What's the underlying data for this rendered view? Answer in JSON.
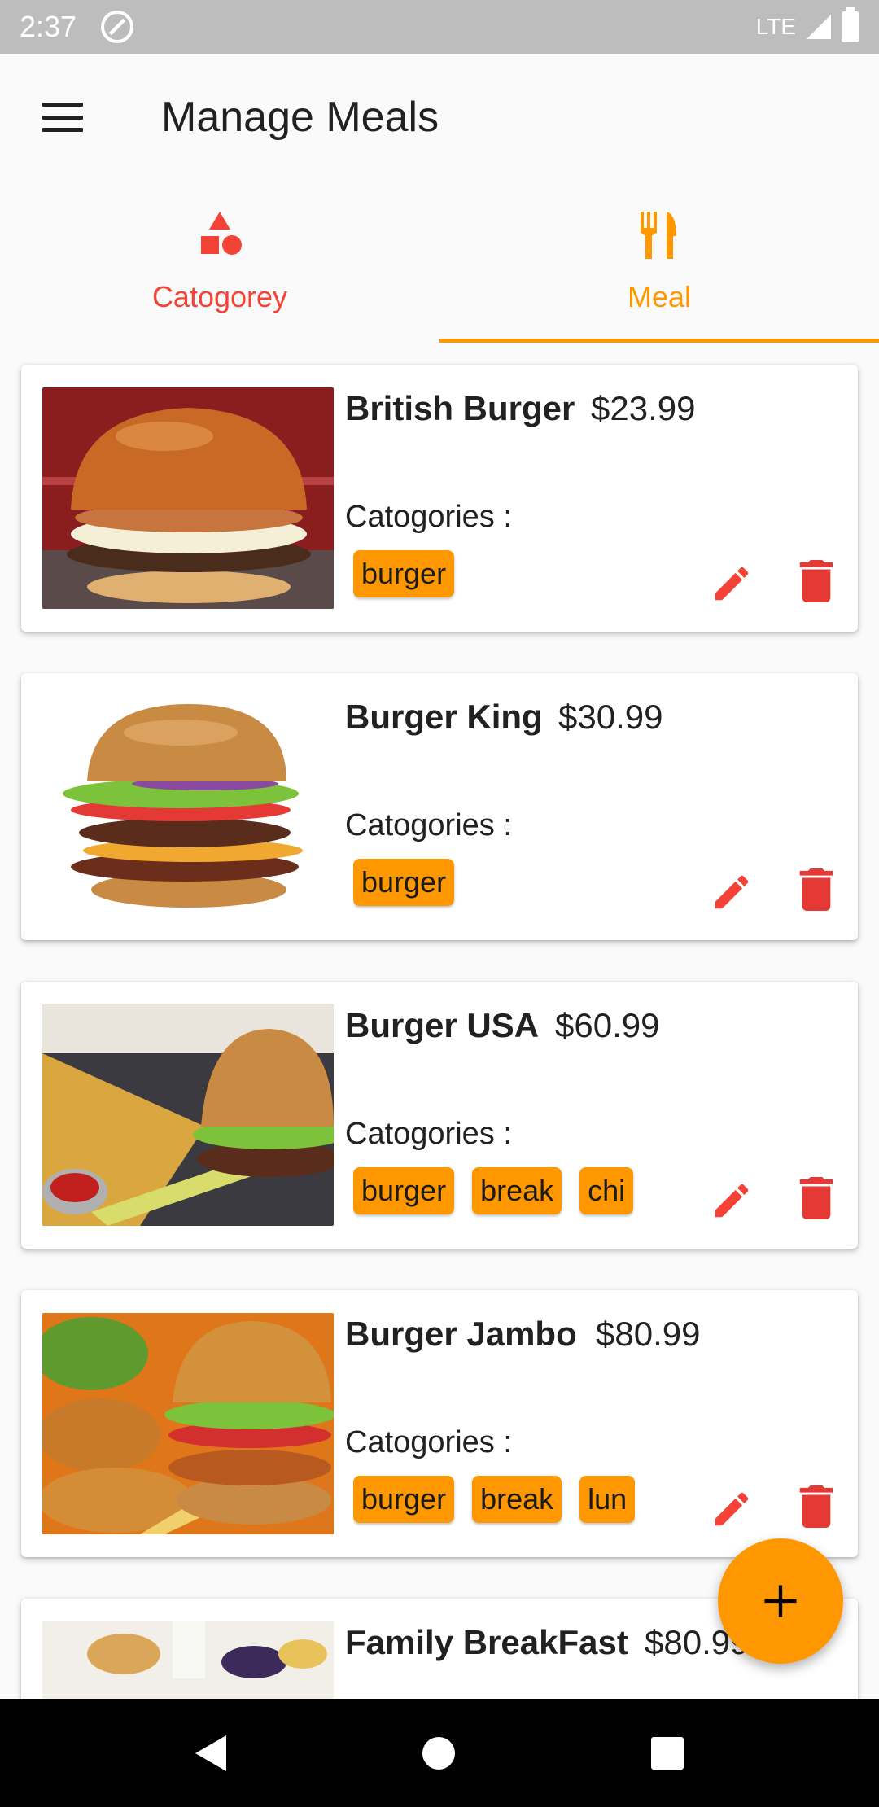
{
  "status_bar": {
    "time": "2:37",
    "network": "LTE"
  },
  "app_bar": {
    "title": "Manage Meals"
  },
  "tabs": [
    {
      "label": "Catogorey",
      "icon": "category-shapes-icon",
      "color": "#f44336"
    },
    {
      "label": "Meal",
      "icon": "restaurant-icon",
      "color": "#ff9800",
      "selected": true
    }
  ],
  "colors": {
    "accent": "#ff9800",
    "danger": "#f44336",
    "delete": "#e53935"
  },
  "meals": [
    {
      "name": "British Burger",
      "price": "$23.99",
      "categories_label": "Catogories :",
      "chips": [
        "burger"
      ]
    },
    {
      "name": "Burger King",
      "price": "$30.99",
      "categories_label": "Catogories :",
      "chips": [
        "burger"
      ]
    },
    {
      "name": "Burger USA",
      "price": "$60.99",
      "categories_label": "Catogories :",
      "chips": [
        "burger",
        "break",
        "chi"
      ]
    },
    {
      "name": "Burger Jambo",
      "price": "$80.99",
      "categories_label": "Catogories :",
      "chips": [
        "burger",
        "break",
        "lun"
      ]
    },
    {
      "name": "Family BreakFast",
      "price": "$80.99",
      "categories_label": "",
      "chips": []
    }
  ]
}
